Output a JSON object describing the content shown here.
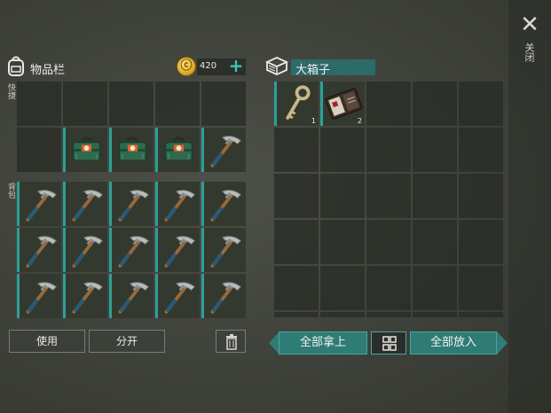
{
  "close": {
    "label": "关闭",
    "icon": "close-icon"
  },
  "inventory": {
    "title": "物品栏",
    "coins": "420",
    "quickbar_label": "快捷",
    "backpack_label": "背包",
    "quickbar": [
      [
        null,
        null,
        null,
        null,
        null
      ],
      [
        null,
        {
          "icon": "toolbox-icon"
        },
        {
          "icon": "toolbox-icon"
        },
        {
          "icon": "toolbox-icon"
        },
        {
          "icon": "pickaxe-icon"
        }
      ]
    ],
    "backpack": [
      [
        "pickaxe-icon",
        "pickaxe-icon",
        "pickaxe-icon",
        "pickaxe-icon",
        "pickaxe-icon"
      ],
      [
        "pickaxe-icon",
        "pickaxe-icon",
        "pickaxe-icon",
        "pickaxe-icon",
        "pickaxe-icon"
      ],
      [
        "pickaxe-icon",
        "pickaxe-icon",
        "pickaxe-icon",
        "pickaxe-icon",
        "pickaxe-icon"
      ]
    ],
    "use_label": "使用",
    "split_label": "分开"
  },
  "chest": {
    "title": "大箱子",
    "items": [
      {
        "icon": "key-icon",
        "qty": "1"
      },
      {
        "icon": "notebook-icon",
        "qty": "2"
      }
    ],
    "take_all_label": "全部拿上",
    "put_all_label": "全部放入"
  },
  "colors": {
    "accent": "#2aa198",
    "teal_button": "#2f7b76",
    "coin": "#d6a218"
  }
}
